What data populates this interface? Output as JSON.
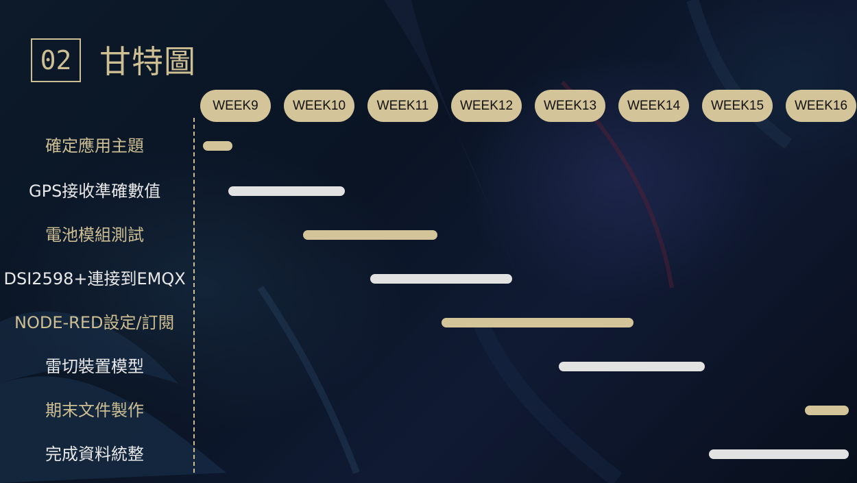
{
  "slide": {
    "number": "02",
    "title": "甘特圖"
  },
  "weeks": [
    "WEEK9",
    "WEEK10",
    "WEEK11",
    "WEEK12",
    "WEEK13",
    "WEEK14",
    "WEEK15",
    "WEEK16"
  ],
  "tasks": [
    {
      "label": "確定應用主題",
      "color": "gold",
      "start_week": 9.0,
      "end_week": 9.35
    },
    {
      "label": "GPS接收準確數值",
      "color": "white",
      "start_week": 9.3,
      "end_week": 10.7
    },
    {
      "label": "電池模組測試",
      "color": "gold",
      "start_week": 10.2,
      "end_week": 11.8
    },
    {
      "label": "DSI2598+連接到EMQX",
      "color": "white",
      "start_week": 11.0,
      "end_week": 12.7
    },
    {
      "label": "NODE-RED設定/訂閱",
      "color": "gold",
      "start_week": 11.85,
      "end_week": 14.15
    },
    {
      "label": "雷切裝置模型",
      "color": "white",
      "start_week": 13.25,
      "end_week": 15.0
    },
    {
      "label": "期末文件製作",
      "color": "gold",
      "start_week": 16.2,
      "end_week": 17.0
    },
    {
      "label": "完成資料統整",
      "color": "white",
      "start_week": 15.05,
      "end_week": 16.75
    }
  ],
  "colors": {
    "gold": "#d4c49a",
    "white": "#e2e2e2",
    "background": "#0c1a2a"
  }
}
